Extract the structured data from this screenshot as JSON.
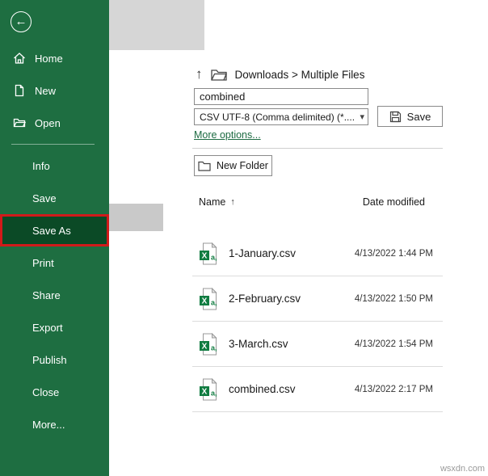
{
  "icons": {
    "back": "←",
    "up": "↑",
    "sort_asc": "↑",
    "caret": "▾"
  },
  "sidebar": {
    "top_items": [
      {
        "label": "Home"
      },
      {
        "label": "New"
      },
      {
        "label": "Open"
      }
    ],
    "bottom_items": [
      {
        "label": "Info"
      },
      {
        "label": "Save"
      },
      {
        "label": "Save As"
      },
      {
        "label": "Print"
      },
      {
        "label": "Share"
      },
      {
        "label": "Export"
      },
      {
        "label": "Publish"
      },
      {
        "label": "Close"
      },
      {
        "label": "More..."
      }
    ]
  },
  "save_panel": {
    "breadcrumb": "Downloads > Multiple Files",
    "filename": "combined",
    "filetype": "CSV UTF-8 (Comma delimited) (*....",
    "save_button": "Save",
    "more_options": "More options...",
    "new_folder_button": "New Folder",
    "columns": {
      "name": "Name",
      "date_modified": "Date modified"
    },
    "files": [
      {
        "name": "1-January.csv",
        "date": "4/13/2022 1:44 PM"
      },
      {
        "name": "2-February.csv",
        "date": "4/13/2022 1:50 PM"
      },
      {
        "name": "3-March.csv",
        "date": "4/13/2022 1:54 PM"
      },
      {
        "name": "combined.csv",
        "date": "4/13/2022 2:17 PM"
      }
    ]
  },
  "watermark": "wsxdn.com",
  "colors": {
    "sidebar_green": "#1e6e41",
    "active_green": "#0b4a26",
    "active_border_red": "#d11a1a",
    "excel_green": "#107c41"
  }
}
